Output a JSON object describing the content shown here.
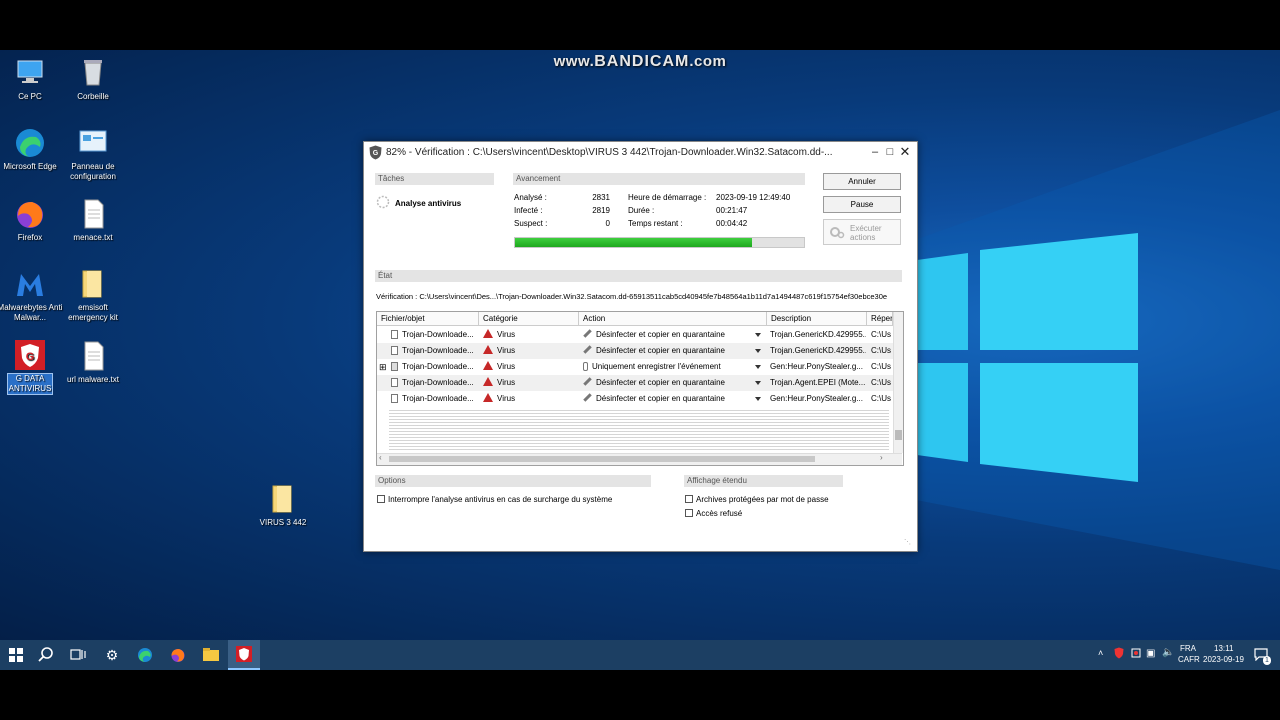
{
  "watermark": {
    "prefix": "www.",
    "brand": "BANDICAM",
    "suffix": ".com"
  },
  "desktop_icons": [
    {
      "label": "Ce PC"
    },
    {
      "label": "Corbeille"
    },
    {
      "label": "Microsoft Edge"
    },
    {
      "label": "Panneau de configuration"
    },
    {
      "label": "Firefox"
    },
    {
      "label": "menace.txt"
    },
    {
      "label": "Malwarebytes Anti Malwar..."
    },
    {
      "label": "emsisoft emergency kit"
    },
    {
      "label": "G DATA ANTIVIRUS"
    },
    {
      "label": "url malware.txt"
    },
    {
      "label": "VIRUS 3 442"
    }
  ],
  "window": {
    "title": "82% - Vérification : C:\\Users\\vincent\\Desktop\\VIRUS 3 442\\Trojan-Downloader.Win32.Satacom.dd-...",
    "tasks_header": "Tâches",
    "task_label": "Analyse antivirus",
    "progress_header": "Avancement",
    "stats": {
      "analyzed_label": "Analysé :",
      "analyzed": "2831",
      "infected_label": "Infecté :",
      "infected": "2819",
      "suspect_label": "Suspect :",
      "suspect": "0",
      "start_label": "Heure de démarrage :",
      "start": "2023-09-19 12:49:40",
      "duration_label": "Durée :",
      "duration": "00:21:47",
      "remaining_label": "Temps restant :",
      "remaining": "00:04:42"
    },
    "progress_percent": 82,
    "buttons": {
      "cancel": "Annuler",
      "pause": "Pause",
      "execute": "Exécuter actions"
    },
    "state_header": "État",
    "state_text": "Vérification : C:\\Users\\vincent\\Des...\\Trojan-Downloader.Win32.Satacom.dd-65913511cab5cd40945fe7b48564a1b11d7a1494487c619f15754ef30ebce30e",
    "columns": [
      "Fichier/objet",
      "Catégorie",
      "Action",
      "Description",
      "Réper"
    ],
    "rows": [
      {
        "file": "Trojan-Downloade...",
        "category": "Virus",
        "action": "Désinfecter et copier en quarantaine",
        "description": "Trojan.GenericKD.429955...",
        "path": "C:\\Us"
      },
      {
        "file": "Trojan-Downloade...",
        "category": "Virus",
        "action": "Désinfecter et copier en quarantaine",
        "description": "Trojan.GenericKD.429955...",
        "path": "C:\\Us"
      },
      {
        "file": "Trojan-Downloade...",
        "category": "Virus",
        "action": "Uniquement enregistrer l'événement",
        "description": "Gen:Heur.PonyStealer.g...",
        "path": "C:\\Us"
      },
      {
        "file": "Trojan-Downloade...",
        "category": "Virus",
        "action": "Désinfecter et copier en quarantaine",
        "description": "Trojan.Agent.EPEI (Mote...",
        "path": "C:\\Us"
      },
      {
        "file": "Trojan-Downloade...",
        "category": "Virus",
        "action": "Désinfecter et copier en quarantaine",
        "description": "Gen:Heur.PonyStealer.g...",
        "path": "C:\\Us"
      }
    ],
    "options_header": "Options",
    "option_interrupt": "Interrompre l'analyse antivirus en cas de surcharge du système",
    "extended_header": "Affichage étendu",
    "ext_archives": "Archives protégées par mot de passe",
    "ext_access": "Accès refusé"
  },
  "taskbar": {
    "lang1": "FRA",
    "lang2": "CAFR",
    "time": "13:11",
    "date": "2023-09-19",
    "notif_count": "1"
  }
}
